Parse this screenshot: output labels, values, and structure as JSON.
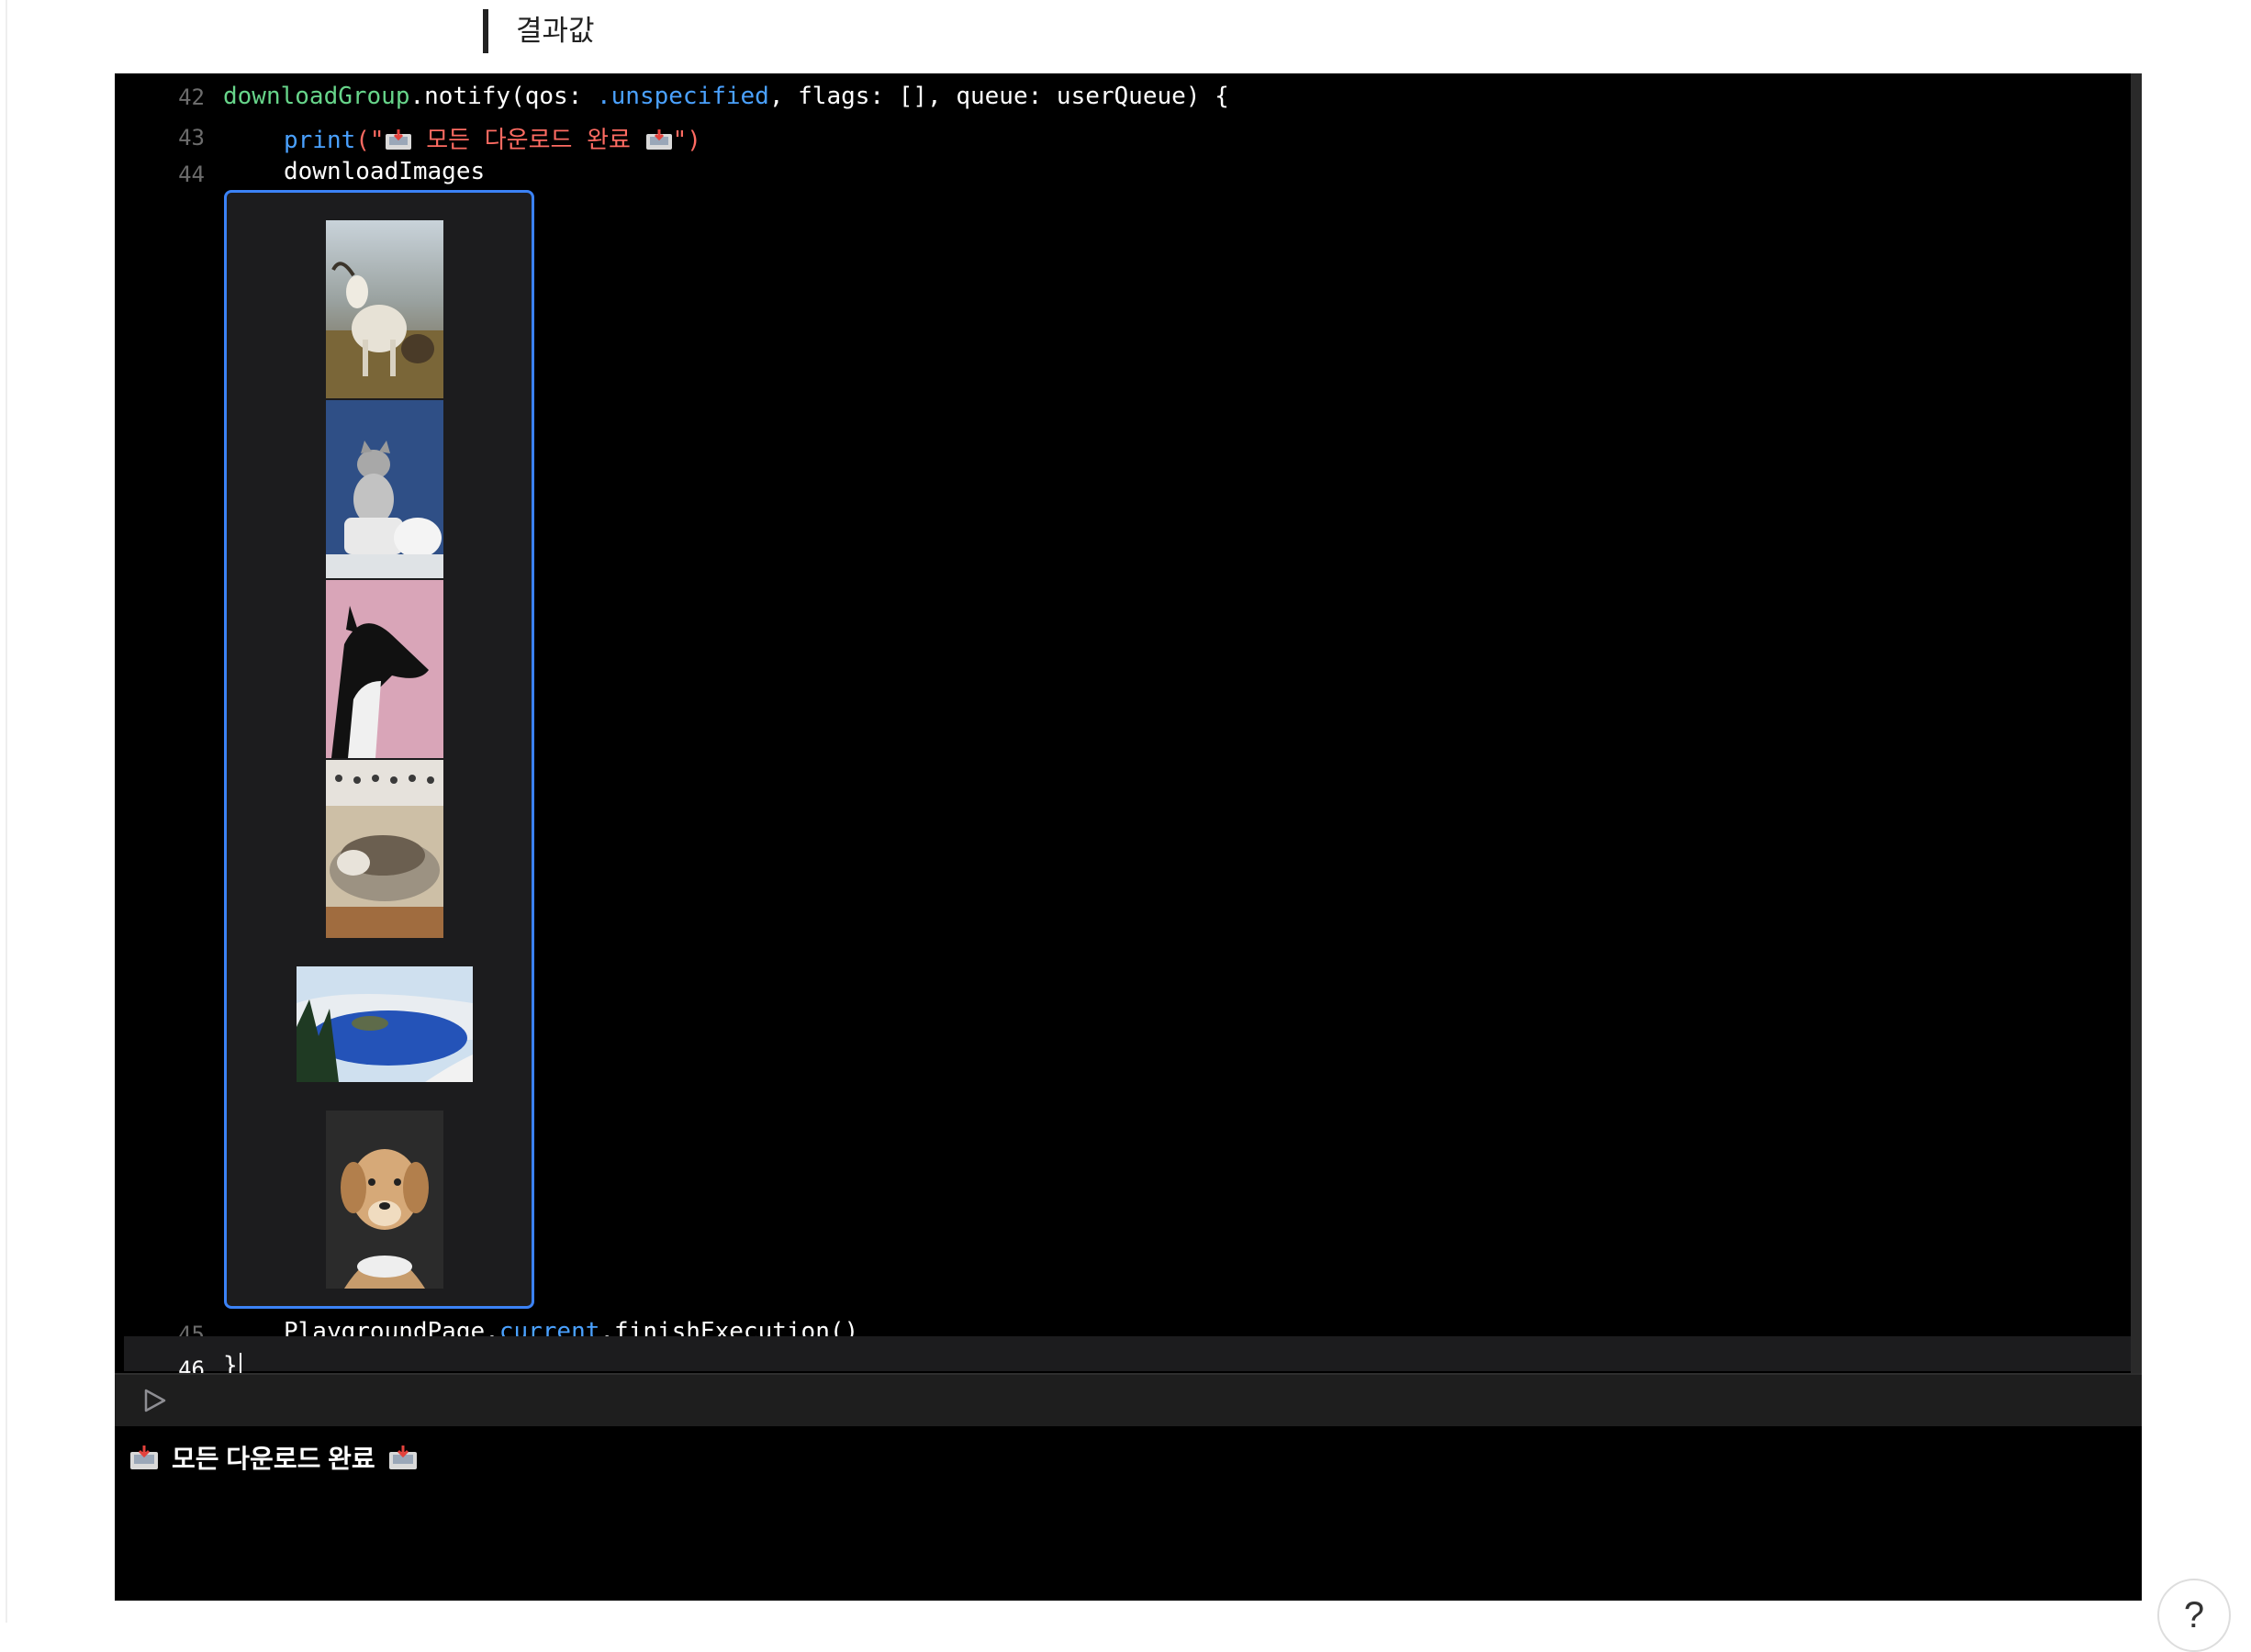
{
  "heading": "결과값",
  "editor": {
    "lines": [
      {
        "num": "42",
        "parts": [
          "downloadGroup",
          ".notify(qos: ",
          ".unspecified",
          ", flags: [], queue: userQueue) {"
        ]
      },
      {
        "num": "43",
        "parts": [
          "print",
          "(\"",
          " 모든 다운로드 완료 ",
          "\")"
        ]
      },
      {
        "num": "44",
        "text": "downloadImages"
      },
      {
        "num": "45",
        "parts": [
          "PlaygroundPage.",
          "current",
          ".finishExecution()"
        ]
      },
      {
        "num": "46",
        "text": "}"
      }
    ],
    "preview_images": [
      "goat-photo",
      "kitten-photo",
      "greyhound-photo",
      "tabby-cat-photo",
      "crater-lake-photo",
      "dog-photo"
    ]
  },
  "console": {
    "output": "모든 다운로드 완료"
  },
  "help": {
    "label": "?"
  },
  "icons": {
    "run": "play-icon",
    "inbox": "inbox-tray-icon",
    "help": "help-icon"
  },
  "colors": {
    "background": "#000000",
    "identifier": "#67d58a",
    "keyword": "#4aa1ff",
    "string": "#ff6b62",
    "preview_border": "#3b82f6"
  }
}
